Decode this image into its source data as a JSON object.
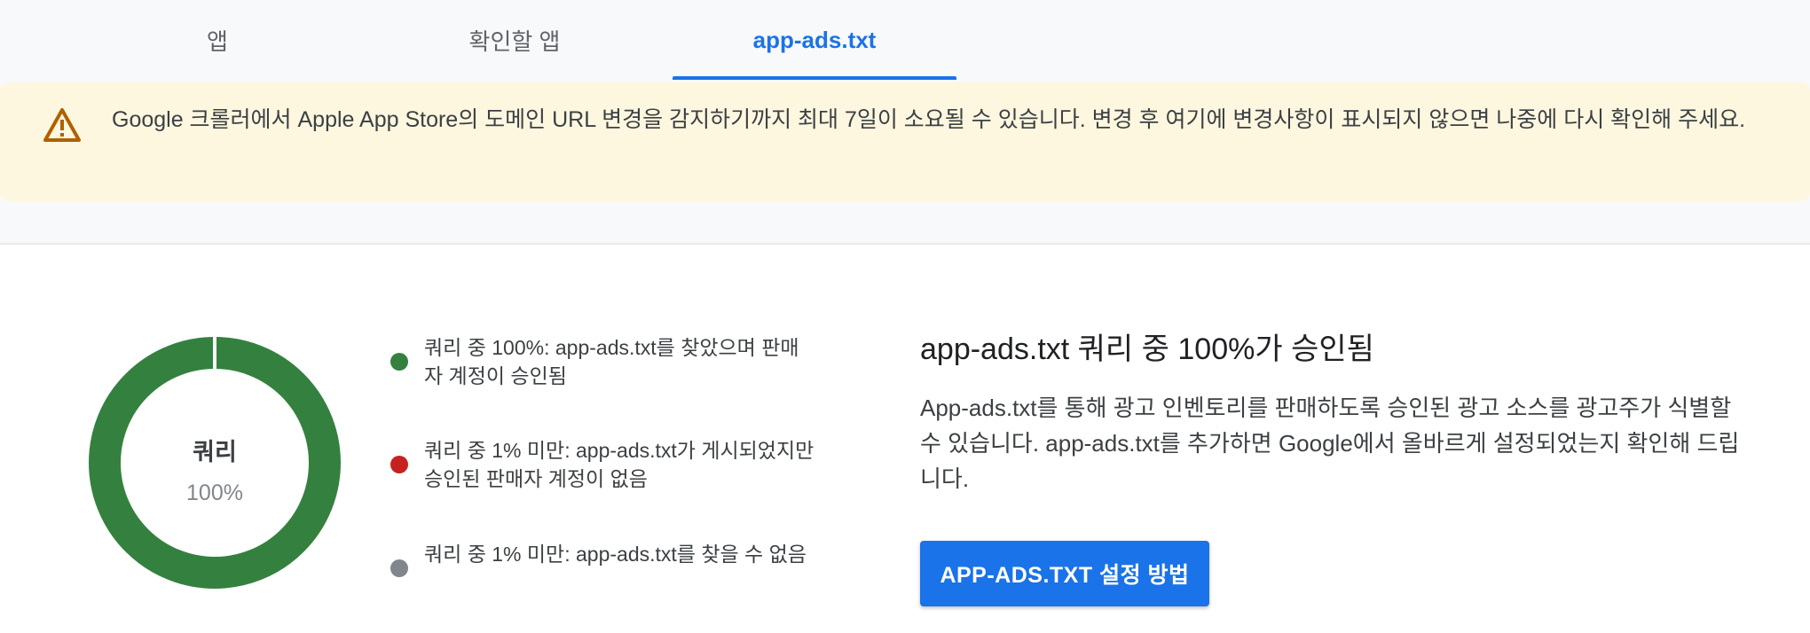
{
  "tabs": [
    {
      "label": "앱",
      "active": false
    },
    {
      "label": "확인할 앱",
      "active": false
    },
    {
      "label": "app-ads.txt",
      "active": true
    }
  ],
  "banner": {
    "icon": "warning-icon",
    "message": "Google 크롤러에서 Apple App Store의 도메인 URL 변경을 감지하기까지 최대 7일이 소요될 수 있습니다. 변경 후 여기에 변경사항이 표시되지 않으면 나중에 다시 확인해 주세요."
  },
  "summary": {
    "donut_label": "쿼리",
    "donut_value": "100%",
    "legend": [
      {
        "text": "쿼리 중 100%: app-ads.txt를 찾았으며 판매자 계정이 승인됨",
        "color": "#34813f",
        "share": 100
      },
      {
        "text": "쿼리 중 1% 미만: app-ads.txt가 게시되었지만 승인된 판매자 계정이 없음",
        "color": "#c5221f",
        "share": 0
      },
      {
        "text": "쿼리 중 1% 미만: app-ads.txt를 찾을 수 없음",
        "color": "#80868b",
        "share": 0
      }
    ],
    "headline": "app-ads.txt 쿼리 중 100%가 승인됨",
    "description": "App-ads.txt를 통해 광고 인벤토리를 판매하도록 승인된 광고 소스를 광고주가 식별할 수 있습니다. app-ads.txt를 추가하면 Google에서 올바르게 설정되었는지 확인해 드립니다.",
    "cta_label": "APP-ADS.TXT 설정 방법"
  },
  "colors": {
    "accent": "#1a73e8",
    "warning_bg": "#fef7e0",
    "warning_icon": "#b06000"
  }
}
